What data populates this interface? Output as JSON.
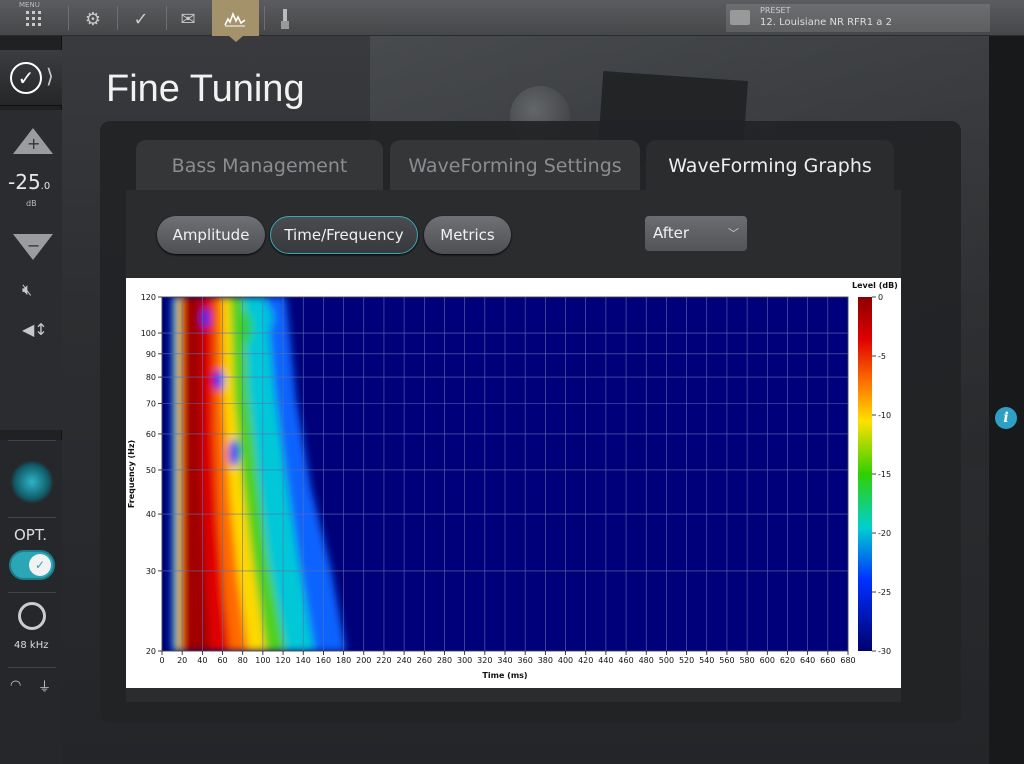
{
  "topbar": {
    "menu_label": "MENU",
    "icons": [
      "grid-icon",
      "settings-icon",
      "check-icon",
      "mail-icon",
      "waveform-icon",
      "audio-cable-icon"
    ],
    "preset_label": "PRESET",
    "preset_value": "12. Louisiane NR RFR1 a 2"
  },
  "sidebar": {
    "volume": "-25",
    "volume_decimal": ".0",
    "volume_unit": "dB",
    "input_label": "OPT.",
    "sample_rate": "48 kHz"
  },
  "page": {
    "title": "Fine Tuning"
  },
  "tabs": [
    {
      "label": "Bass Management",
      "active": false
    },
    {
      "label": "WaveForming Settings",
      "active": false
    },
    {
      "label": "WaveForming Graphs",
      "active": true
    }
  ],
  "view_buttons": [
    {
      "label": "Amplitude",
      "active": false
    },
    {
      "label": "Time/Frequency",
      "active": true
    },
    {
      "label": "Metrics",
      "active": false
    }
  ],
  "dropdown": {
    "selected": "After"
  },
  "colors": {
    "accent": "#39a8b6",
    "tab_active_bg": "#a3926a"
  },
  "chart_data": {
    "type": "heatmap",
    "xlabel": "Time (ms)",
    "ylabel": "Frequency (Hz)",
    "xlim": [
      0,
      680
    ],
    "ylim": [
      20,
      120
    ],
    "yscale": "log",
    "x_ticks": [
      0,
      20,
      40,
      60,
      80,
      100,
      120,
      140,
      160,
      180,
      200,
      220,
      240,
      260,
      280,
      300,
      320,
      340,
      360,
      380,
      400,
      420,
      440,
      460,
      480,
      500,
      520,
      540,
      560,
      580,
      600,
      620,
      640,
      660,
      680
    ],
    "y_ticks": [
      20,
      30,
      40,
      50,
      60,
      70,
      80,
      90,
      100,
      120
    ],
    "colorbar": {
      "label": "Level (dB)",
      "range": [
        -30,
        0
      ],
      "ticks": [
        0,
        -5,
        -10,
        -15,
        -20,
        -25,
        -30
      ]
    },
    "grid": true
  }
}
